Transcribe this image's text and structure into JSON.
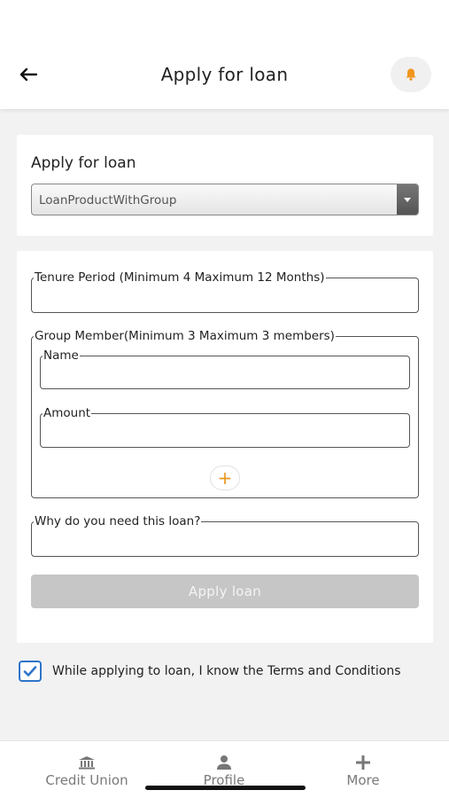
{
  "header": {
    "title": "Apply for loan",
    "back_icon": "arrow-left-icon",
    "bell_icon": "bell-icon",
    "accent_color": "#f0961e"
  },
  "product_card": {
    "heading": "Apply for loan",
    "selected_product": "LoanProductWithGroup"
  },
  "form": {
    "tenure_label": "Tenure Period (Minimum 4 Maximum 12 Months)",
    "tenure_value": "",
    "group_label": "Group Member(Minimum 3 Maximum 3 members)",
    "name_label": "Name",
    "name_value": "",
    "amount_label": "Amount",
    "amount_value": "",
    "add_member_symbol": "+",
    "reason_label": "Why do you need this loan?",
    "reason_value": "",
    "apply_label": "Apply loan"
  },
  "terms": {
    "checked": true,
    "text": "While applying to loan, I know the Terms and Conditions",
    "check_color": "#2e74c9"
  },
  "nav": {
    "items": [
      {
        "label": "Credit Union",
        "icon": "bank-icon"
      },
      {
        "label": "Profile",
        "icon": "person-icon"
      },
      {
        "label": "More",
        "icon": "plus-icon"
      }
    ]
  }
}
